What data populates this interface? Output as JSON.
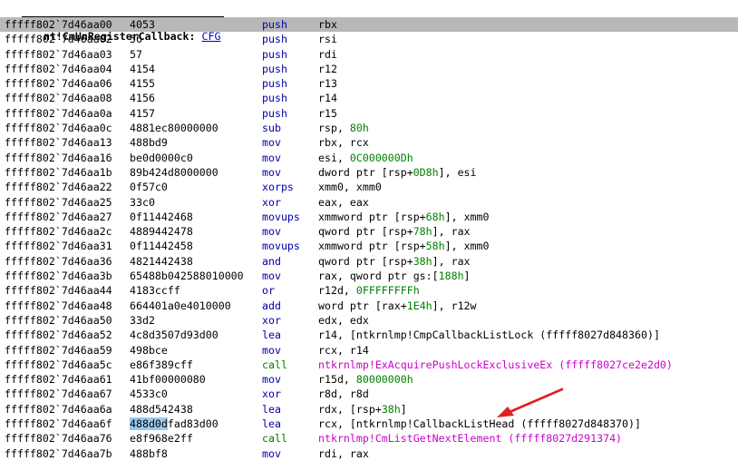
{
  "header": {
    "function_name": "nt!CmUnRegisterCallback:",
    "link_label": "CFG"
  },
  "colors": {
    "selection": "#b8b8b8",
    "mnemonic": "#0000aa",
    "immediate": "#008000",
    "call_target": "#cc00cc",
    "bytes_highlight": "#99c9ef",
    "arrow": "#e02020"
  },
  "rows": [
    {
      "addr": "fffff802`7d46aa00",
      "bytes": "4053",
      "mnemonic": "push",
      "parts": [
        {
          "t": "rbx"
        }
      ],
      "selected": true
    },
    {
      "addr": "fffff802`7d46aa02",
      "bytes": "56",
      "mnemonic": "push",
      "parts": [
        {
          "t": "rsi"
        }
      ]
    },
    {
      "addr": "fffff802`7d46aa03",
      "bytes": "57",
      "mnemonic": "push",
      "parts": [
        {
          "t": "rdi"
        }
      ]
    },
    {
      "addr": "fffff802`7d46aa04",
      "bytes": "4154",
      "mnemonic": "push",
      "parts": [
        {
          "t": "r12"
        }
      ]
    },
    {
      "addr": "fffff802`7d46aa06",
      "bytes": "4155",
      "mnemonic": "push",
      "parts": [
        {
          "t": "r13"
        }
      ]
    },
    {
      "addr": "fffff802`7d46aa08",
      "bytes": "4156",
      "mnemonic": "push",
      "parts": [
        {
          "t": "r14"
        }
      ]
    },
    {
      "addr": "fffff802`7d46aa0a",
      "bytes": "4157",
      "mnemonic": "push",
      "parts": [
        {
          "t": "r15"
        }
      ]
    },
    {
      "addr": "fffff802`7d46aa0c",
      "bytes": "4881ec80000000",
      "mnemonic": "sub",
      "parts": [
        {
          "t": "rsp, "
        },
        {
          "t": "80h",
          "c": "green"
        }
      ]
    },
    {
      "addr": "fffff802`7d46aa13",
      "bytes": "488bd9",
      "mnemonic": "mov",
      "parts": [
        {
          "t": "rbx, rcx"
        }
      ]
    },
    {
      "addr": "fffff802`7d46aa16",
      "bytes": "be0d0000c0",
      "mnemonic": "mov",
      "parts": [
        {
          "t": "esi, "
        },
        {
          "t": "0C000000Dh",
          "c": "green"
        }
      ]
    },
    {
      "addr": "fffff802`7d46aa1b",
      "bytes": "89b424d8000000",
      "mnemonic": "mov",
      "parts": [
        {
          "t": "dword ptr [rsp+"
        },
        {
          "t": "0D8h",
          "c": "green"
        },
        {
          "t": "], esi"
        }
      ]
    },
    {
      "addr": "fffff802`7d46aa22",
      "bytes": "0f57c0",
      "mnemonic": "xorps",
      "parts": [
        {
          "t": "xmm0, xmm0"
        }
      ]
    },
    {
      "addr": "fffff802`7d46aa25",
      "bytes": "33c0",
      "mnemonic": "xor",
      "parts": [
        {
          "t": "eax, eax"
        }
      ]
    },
    {
      "addr": "fffff802`7d46aa27",
      "bytes": "0f11442468",
      "mnemonic": "movups",
      "parts": [
        {
          "t": "xmmword ptr [rsp+"
        },
        {
          "t": "68h",
          "c": "green"
        },
        {
          "t": "], xmm0"
        }
      ]
    },
    {
      "addr": "fffff802`7d46aa2c",
      "bytes": "4889442478",
      "mnemonic": "mov",
      "parts": [
        {
          "t": "qword ptr [rsp+"
        },
        {
          "t": "78h",
          "c": "green"
        },
        {
          "t": "], rax"
        }
      ]
    },
    {
      "addr": "fffff802`7d46aa31",
      "bytes": "0f11442458",
      "mnemonic": "movups",
      "parts": [
        {
          "t": "xmmword ptr [rsp+"
        },
        {
          "t": "58h",
          "c": "green"
        },
        {
          "t": "], xmm0"
        }
      ]
    },
    {
      "addr": "fffff802`7d46aa36",
      "bytes": "4821442438",
      "mnemonic": "and",
      "parts": [
        {
          "t": "qword ptr [rsp+"
        },
        {
          "t": "38h",
          "c": "green"
        },
        {
          "t": "], rax"
        }
      ]
    },
    {
      "addr": "fffff802`7d46aa3b",
      "bytes": "65488b042588010000",
      "mnemonic": "mov",
      "parts": [
        {
          "t": "rax, qword ptr gs:["
        },
        {
          "t": "188h",
          "c": "green"
        },
        {
          "t": "]"
        }
      ]
    },
    {
      "addr": "fffff802`7d46aa44",
      "bytes": "4183ccff",
      "mnemonic": "or",
      "parts": [
        {
          "t": "r12d, "
        },
        {
          "t": "0FFFFFFFFh",
          "c": "green"
        }
      ]
    },
    {
      "addr": "fffff802`7d46aa48",
      "bytes": "664401a0e4010000",
      "mnemonic": "add",
      "parts": [
        {
          "t": "word ptr [rax+"
        },
        {
          "t": "1E4h",
          "c": "green"
        },
        {
          "t": "], r12w"
        }
      ]
    },
    {
      "addr": "fffff802`7d46aa50",
      "bytes": "33d2",
      "mnemonic": "xor",
      "parts": [
        {
          "t": "edx, edx"
        }
      ]
    },
    {
      "addr": "fffff802`7d46aa52",
      "bytes": "4c8d3507d93d00",
      "mnemonic": "lea",
      "parts": [
        {
          "t": "r14, [ntkrnlmp!CmpCallbackListLock (fffff8027d848360)]"
        }
      ]
    },
    {
      "addr": "fffff802`7d46aa59",
      "bytes": "498bce",
      "mnemonic": "mov",
      "parts": [
        {
          "t": "rcx, r14"
        }
      ]
    },
    {
      "addr": "fffff802`7d46aa5c",
      "bytes": "e86f389cff",
      "mnemonic": "call",
      "mcolor": "green",
      "parts": [
        {
          "t": "ntkrnlmp!ExAcquirePushLockExclusiveEx (fffff8027ce2e2d0)",
          "c": "magenta"
        }
      ]
    },
    {
      "addr": "fffff802`7d46aa61",
      "bytes": "41bf00000080",
      "mnemonic": "mov",
      "parts": [
        {
          "t": "r15d, "
        },
        {
          "t": "80000000h",
          "c": "green"
        }
      ]
    },
    {
      "addr": "fffff802`7d46aa67",
      "bytes": "4533c0",
      "mnemonic": "xor",
      "parts": [
        {
          "t": "r8d, r8d"
        }
      ]
    },
    {
      "addr": "fffff802`7d46aa6a",
      "bytes": "488d542438",
      "mnemonic": "lea",
      "parts": [
        {
          "t": "rdx, [rsp+"
        },
        {
          "t": "38h",
          "c": "green"
        },
        {
          "t": "]"
        }
      ]
    },
    {
      "addr": "fffff802`7d46aa6f",
      "bytes": "488d0dfad83d00",
      "bytes_hl": "488d0d",
      "mnemonic": "lea",
      "parts": [
        {
          "t": "rcx, [ntkrnlmp!CallbackListHead (fffff8027d848370)]"
        }
      ]
    },
    {
      "addr": "fffff802`7d46aa76",
      "bytes": "e8f968e2ff",
      "mnemonic": "call",
      "mcolor": "green",
      "parts": [
        {
          "t": "ntkrnlmp!CmListGetNextElement (fffff8027d291374)",
          "c": "magenta"
        }
      ]
    },
    {
      "addr": "fffff802`7d46aa7b",
      "bytes": "488bf8",
      "mnemonic": "mov",
      "parts": [
        {
          "t": "rdi, rax"
        }
      ]
    }
  ]
}
